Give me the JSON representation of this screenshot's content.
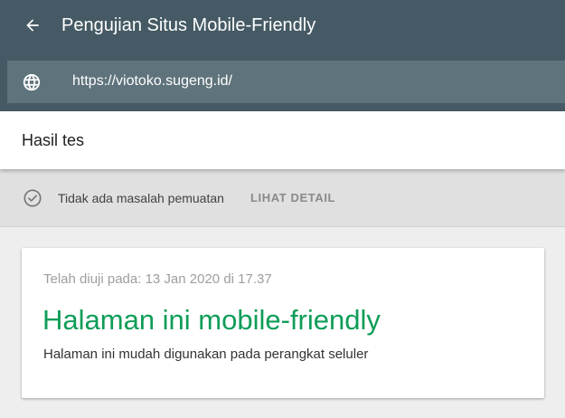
{
  "app": {
    "title": "Pengujian Situs Mobile-Friendly",
    "back_icon": "arrow-left-icon"
  },
  "url_bar": {
    "icon": "globe-icon",
    "url": "https://viotoko.sugeng.id/"
  },
  "results": {
    "title": "Hasil tes"
  },
  "status": {
    "icon": "check-circle-icon",
    "text": "Tidak ada masalah pemuatan",
    "detail_link": "LIHAT DETAIL"
  },
  "card": {
    "tested_on": "Telah diuji pada: 13 Jan 2020 di 17.37",
    "verdict": "Halaman ini mobile-friendly",
    "verdict_subtitle": "Halaman ini mudah digunakan pada perangkat seluler"
  },
  "colors": {
    "header_bg": "#455a64",
    "url_bar_bg": "#5f737c",
    "verdict_green": "#0f9d58"
  }
}
